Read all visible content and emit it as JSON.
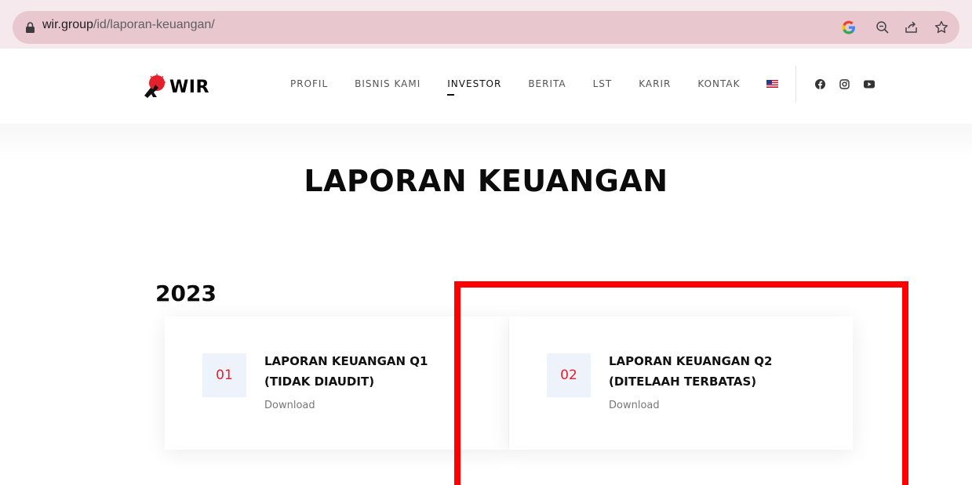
{
  "browser": {
    "url_host": "wir.group",
    "url_path": "/id/laporan-keuangan/",
    "icons": [
      "lock-icon",
      "google-icon",
      "zoom-icon",
      "share-icon",
      "star-icon"
    ]
  },
  "site": {
    "logo_text": "WIR",
    "nav": [
      {
        "label": "PROFIL"
      },
      {
        "label": "BISNIS KAMI"
      },
      {
        "label": "INVESTOR",
        "active": true
      },
      {
        "label": "BERITA"
      },
      {
        "label": "LST"
      },
      {
        "label": "KARIR"
      },
      {
        "label": "KONTAK"
      }
    ],
    "social": [
      "facebook-icon",
      "instagram-icon",
      "youtube-icon"
    ]
  },
  "page": {
    "title": "LAPORAN KEUANGAN",
    "year": "2023",
    "reports": [
      {
        "number": "01",
        "title_line1": "LAPORAN KEUANGAN Q1",
        "title_line2": "(TIDAK DIAUDIT)",
        "link": "Download"
      },
      {
        "number": "02",
        "title_line1": "LAPORAN KEUANGAN Q2",
        "title_line2": "(DITELAAH TERBATAS)",
        "link": "Download"
      }
    ]
  },
  "colors": {
    "accent_red": "#e3202b",
    "highlight": "#ff0000",
    "chrome_bar": "#e8c7ce"
  }
}
